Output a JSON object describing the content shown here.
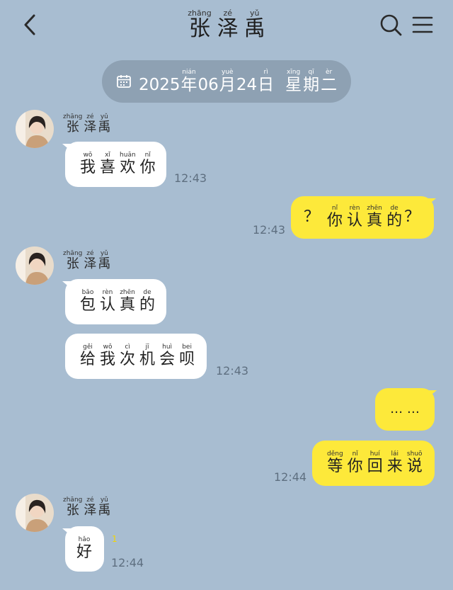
{
  "header": {
    "title": [
      {
        "hz": "张",
        "py": "zhāng"
      },
      {
        "hz": "泽",
        "py": "zé"
      },
      {
        "hz": "禹",
        "py": "yǔ"
      }
    ]
  },
  "date": {
    "year": "2025",
    "year_char": {
      "hz": "年",
      "py": "nián"
    },
    "month": "06",
    "month_char": {
      "hz": "月",
      "py": "yuè"
    },
    "day": "24",
    "day_char": {
      "hz": "日",
      "py": "rì"
    },
    "weekday": [
      {
        "hz": "星",
        "py": "xīng"
      },
      {
        "hz": "期",
        "py": "qī"
      },
      {
        "hz": "二",
        "py": "èr"
      }
    ]
  },
  "sender_name": [
    {
      "hz": "张",
      "py": "zhāng"
    },
    {
      "hz": "泽",
      "py": "zé"
    },
    {
      "hz": "禹",
      "py": "yǔ"
    }
  ],
  "messages": [
    {
      "chars": [
        {
          "hz": "我",
          "py": "wǒ"
        },
        {
          "hz": "喜",
          "py": "xǐ"
        },
        {
          "hz": "欢",
          "py": "huān"
        },
        {
          "hz": "你",
          "py": "nǐ"
        }
      ],
      "time": "12:43"
    },
    {
      "prefix": "？",
      "chars": [
        {
          "hz": "你",
          "py": "nǐ"
        },
        {
          "hz": "认",
          "py": "rèn"
        },
        {
          "hz": "真",
          "py": "zhēn"
        },
        {
          "hz": "的",
          "py": "de"
        }
      ],
      "suffix": "？",
      "time": "12:43"
    },
    {
      "chars": [
        {
          "hz": "包",
          "py": "bāo"
        },
        {
          "hz": "认",
          "py": "rèn"
        },
        {
          "hz": "真",
          "py": "zhēn"
        },
        {
          "hz": "的",
          "py": "de"
        }
      ]
    },
    {
      "chars": [
        {
          "hz": "给",
          "py": "gěi"
        },
        {
          "hz": "我",
          "py": "wǒ"
        },
        {
          "hz": "次",
          "py": "cì"
        },
        {
          "hz": "机",
          "py": "jī"
        },
        {
          "hz": "会",
          "py": "huì"
        },
        {
          "hz": "呗",
          "py": "bei"
        }
      ],
      "time": "12:43"
    },
    {
      "text": "… …"
    },
    {
      "chars": [
        {
          "hz": "等",
          "py": "děng"
        },
        {
          "hz": "你",
          "py": "nǐ"
        },
        {
          "hz": "回",
          "py": "huí"
        },
        {
          "hz": "来",
          "py": "lái"
        },
        {
          "hz": "说",
          "py": "shuō"
        }
      ],
      "time": "12:44"
    },
    {
      "chars": [
        {
          "hz": "好",
          "py": "hǎo"
        }
      ],
      "read_mark": "1",
      "time": "12:44"
    }
  ],
  "colors": {
    "background": "#a8bdd1",
    "bubble_in": "#ffffff",
    "bubble_out": "#fde93a",
    "date_pill": "#8ea1b3"
  },
  "icons": [
    "back-arrow-icon",
    "search-icon",
    "menu-icon",
    "calendar-icon"
  ]
}
